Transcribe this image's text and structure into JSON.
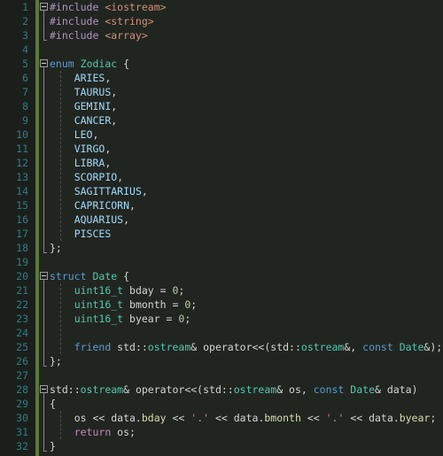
{
  "editor": {
    "language": "C++",
    "theme": "dark",
    "first_visible_line": 1,
    "last_visible_line": 32,
    "line_height_px": 16,
    "colors": {
      "background": "#212520",
      "gutter_background": "#1b1f1b",
      "line_number": "#2d7d86",
      "change_bar_modified": "#587a3c",
      "indent_guide": "#4a4f4a",
      "scope_line": "#848484",
      "default_text": "#d4d4d4",
      "preprocessor": "#b392c6",
      "string": "#ce9178",
      "keyword": "#569cd6",
      "type": "#4ec9b0",
      "enum_member": "#9cdcfe",
      "number": "#b5cea8",
      "control_keyword": "#c586c0",
      "member": "#dcdcaa"
    }
  },
  "line_numbers": [
    1,
    2,
    3,
    4,
    5,
    6,
    7,
    8,
    9,
    10,
    11,
    12,
    13,
    14,
    15,
    16,
    17,
    18,
    19,
    20,
    21,
    22,
    23,
    24,
    25,
    26,
    27,
    28,
    29,
    30,
    31,
    32
  ],
  "fold_markers": [
    {
      "line": 1,
      "state": "expanded"
    },
    {
      "line": 5,
      "state": "expanded"
    },
    {
      "line": 20,
      "state": "expanded"
    },
    {
      "line": 28,
      "state": "expanded"
    }
  ],
  "code_lines": [
    {
      "n": 1,
      "text": "#include <iostream>"
    },
    {
      "n": 2,
      "text": "#include <string>"
    },
    {
      "n": 3,
      "text": "#include <array>"
    },
    {
      "n": 4,
      "text": ""
    },
    {
      "n": 5,
      "text": "enum Zodiac {"
    },
    {
      "n": 6,
      "text": "    ARIES,"
    },
    {
      "n": 7,
      "text": "    TAURUS,"
    },
    {
      "n": 8,
      "text": "    GEMINI,"
    },
    {
      "n": 9,
      "text": "    CANCER,"
    },
    {
      "n": 10,
      "text": "    LEO,"
    },
    {
      "n": 11,
      "text": "    VIRGO,"
    },
    {
      "n": 12,
      "text": "    LIBRA,"
    },
    {
      "n": 13,
      "text": "    SCORPIO,"
    },
    {
      "n": 14,
      "text": "    SAGITTARIUS,"
    },
    {
      "n": 15,
      "text": "    CAPRICORN,"
    },
    {
      "n": 16,
      "text": "    AQUARIUS,"
    },
    {
      "n": 17,
      "text": "    PISCES"
    },
    {
      "n": 18,
      "text": "};"
    },
    {
      "n": 19,
      "text": ""
    },
    {
      "n": 20,
      "text": "struct Date {"
    },
    {
      "n": 21,
      "text": "    uint16_t bday = 0;"
    },
    {
      "n": 22,
      "text": "    uint16_t bmonth = 0;"
    },
    {
      "n": 23,
      "text": "    uint16_t byear = 0;"
    },
    {
      "n": 24,
      "text": ""
    },
    {
      "n": 25,
      "text": "    friend std::ostream& operator<<(std::ostream&, const Date&);"
    },
    {
      "n": 26,
      "text": "};"
    },
    {
      "n": 27,
      "text": ""
    },
    {
      "n": 28,
      "text": "std::ostream& operator<<(std::ostream& os, const Date& data)"
    },
    {
      "n": 29,
      "text": "{"
    },
    {
      "n": 30,
      "text": "    os << data.bday << '.' << data.bmonth << '.' << data.byear;"
    },
    {
      "n": 31,
      "text": "    return os;"
    },
    {
      "n": 32,
      "text": "}"
    }
  ],
  "tokens": {
    "l1": [
      [
        "#include ",
        "t-pre"
      ],
      [
        "<iostream>",
        "t-str"
      ]
    ],
    "l2": [
      [
        "#include ",
        "t-pre"
      ],
      [
        "<string>",
        "t-str"
      ]
    ],
    "l3": [
      [
        "#include ",
        "t-pre"
      ],
      [
        "<array>",
        "t-str"
      ]
    ],
    "l5": [
      [
        "enum",
        "t-key"
      ],
      [
        " ",
        "t-plain"
      ],
      [
        "Zodiac",
        "t-type"
      ],
      [
        " {",
        "t-plain"
      ]
    ],
    "l6": [
      [
        "    ",
        "t-plain"
      ],
      [
        "ARIES",
        "t-enum"
      ],
      [
        ",",
        "t-plain"
      ]
    ],
    "l7": [
      [
        "    ",
        "t-plain"
      ],
      [
        "TAURUS",
        "t-enum"
      ],
      [
        ",",
        "t-plain"
      ]
    ],
    "l8": [
      [
        "    ",
        "t-plain"
      ],
      [
        "GEMINI",
        "t-enum"
      ],
      [
        ",",
        "t-plain"
      ]
    ],
    "l9": [
      [
        "    ",
        "t-plain"
      ],
      [
        "CANCER",
        "t-enum"
      ],
      [
        ",",
        "t-plain"
      ]
    ],
    "l10": [
      [
        "    ",
        "t-plain"
      ],
      [
        "LEO",
        "t-enum"
      ],
      [
        ",",
        "t-plain"
      ]
    ],
    "l11": [
      [
        "    ",
        "t-plain"
      ],
      [
        "VIRGO",
        "t-enum"
      ],
      [
        ",",
        "t-plain"
      ]
    ],
    "l12": [
      [
        "    ",
        "t-plain"
      ],
      [
        "LIBRA",
        "t-enum"
      ],
      [
        ",",
        "t-plain"
      ]
    ],
    "l13": [
      [
        "    ",
        "t-plain"
      ],
      [
        "SCORPIO",
        "t-enum"
      ],
      [
        ",",
        "t-plain"
      ]
    ],
    "l14": [
      [
        "    ",
        "t-plain"
      ],
      [
        "SAGITTARIUS",
        "t-enum"
      ],
      [
        ",",
        "t-plain"
      ]
    ],
    "l15": [
      [
        "    ",
        "t-plain"
      ],
      [
        "CAPRICORN",
        "t-enum"
      ],
      [
        ",",
        "t-plain"
      ]
    ],
    "l16": [
      [
        "    ",
        "t-plain"
      ],
      [
        "AQUARIUS",
        "t-enum"
      ],
      [
        ",",
        "t-plain"
      ]
    ],
    "l17": [
      [
        "    ",
        "t-plain"
      ],
      [
        "PISCES",
        "t-enum"
      ]
    ],
    "l18": [
      [
        "};",
        "t-plain"
      ]
    ],
    "l20": [
      [
        "struct",
        "t-key"
      ],
      [
        " ",
        "t-plain"
      ],
      [
        "Date",
        "t-type"
      ],
      [
        " {",
        "t-plain"
      ]
    ],
    "l21": [
      [
        "    ",
        "t-plain"
      ],
      [
        "uint16_t",
        "t-type"
      ],
      [
        " bday = ",
        "t-plain"
      ],
      [
        "0",
        "t-num"
      ],
      [
        ";",
        "t-plain"
      ]
    ],
    "l22": [
      [
        "    ",
        "t-plain"
      ],
      [
        "uint16_t",
        "t-type"
      ],
      [
        " bmonth = ",
        "t-plain"
      ],
      [
        "0",
        "t-num"
      ],
      [
        ";",
        "t-plain"
      ]
    ],
    "l23": [
      [
        "    ",
        "t-plain"
      ],
      [
        "uint16_t",
        "t-type"
      ],
      [
        " byear = ",
        "t-plain"
      ],
      [
        "0",
        "t-num"
      ],
      [
        ";",
        "t-plain"
      ]
    ],
    "l25": [
      [
        "    ",
        "t-plain"
      ],
      [
        "friend",
        "t-key"
      ],
      [
        " std::",
        "t-plain"
      ],
      [
        "ostream",
        "t-type"
      ],
      [
        "& operator<<(std::",
        "t-plain"
      ],
      [
        "ostream",
        "t-type"
      ],
      [
        "&, ",
        "t-plain"
      ],
      [
        "const",
        "t-key"
      ],
      [
        " ",
        "t-plain"
      ],
      [
        "Date",
        "t-type"
      ],
      [
        "&);",
        "t-plain"
      ]
    ],
    "l26": [
      [
        "};",
        "t-plain"
      ]
    ],
    "l28": [
      [
        "std::",
        "t-plain"
      ],
      [
        "ostream",
        "t-type"
      ],
      [
        "& operator<<(std::",
        "t-plain"
      ],
      [
        "ostream",
        "t-type"
      ],
      [
        "& os, ",
        "t-plain"
      ],
      [
        "const",
        "t-key"
      ],
      [
        " ",
        "t-plain"
      ],
      [
        "Date",
        "t-type"
      ],
      [
        "& data)",
        "t-plain"
      ]
    ],
    "l29": [
      [
        "{",
        "t-plain"
      ]
    ],
    "l30": [
      [
        "    os << data.",
        "t-plain"
      ],
      [
        "bday",
        "t-memb"
      ],
      [
        " << ",
        "t-plain"
      ],
      [
        "'.'",
        "t-str"
      ],
      [
        " << data.",
        "t-plain"
      ],
      [
        "bmonth",
        "t-memb"
      ],
      [
        " << ",
        "t-plain"
      ],
      [
        "'.'",
        "t-str"
      ],
      [
        " << data.",
        "t-plain"
      ],
      [
        "byear",
        "t-memb"
      ],
      [
        ";",
        "t-plain"
      ]
    ],
    "l31": [
      [
        "    ",
        "t-plain"
      ],
      [
        "return",
        "t-ctrl"
      ],
      [
        " os;",
        "t-plain"
      ]
    ],
    "l32": [
      [
        "}",
        "t-plain"
      ]
    ]
  }
}
